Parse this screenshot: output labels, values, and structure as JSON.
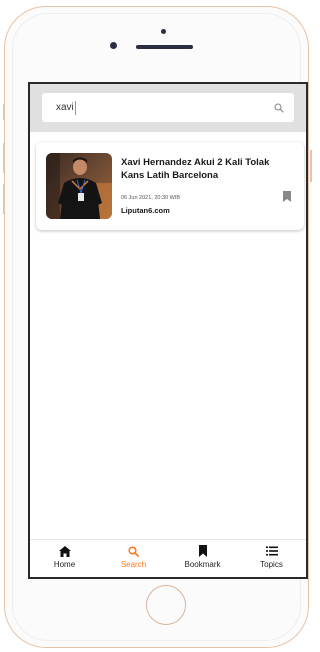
{
  "search": {
    "value": "xavi",
    "icon": "search-icon"
  },
  "results": [
    {
      "title": "Xavi Hernandez Akui 2 Kali Tolak Kans Latih Barcelona",
      "date": "06 Jun 2021, 20:30 WIB",
      "source": "Liputan6.com",
      "bookmark_icon": "bookmark-icon"
    }
  ],
  "nav": {
    "items": [
      {
        "label": "Home",
        "icon": "home-icon",
        "active": false
      },
      {
        "label": "Search",
        "icon": "search-icon",
        "active": true
      },
      {
        "label": "Bookmark",
        "icon": "bookmark-icon",
        "active": false
      },
      {
        "label": "Topics",
        "icon": "list-icon",
        "active": false
      }
    ]
  },
  "colors": {
    "accent": "#ff7a1a",
    "frame": "#e7c2a8",
    "search_band": "#e0e0e0"
  }
}
